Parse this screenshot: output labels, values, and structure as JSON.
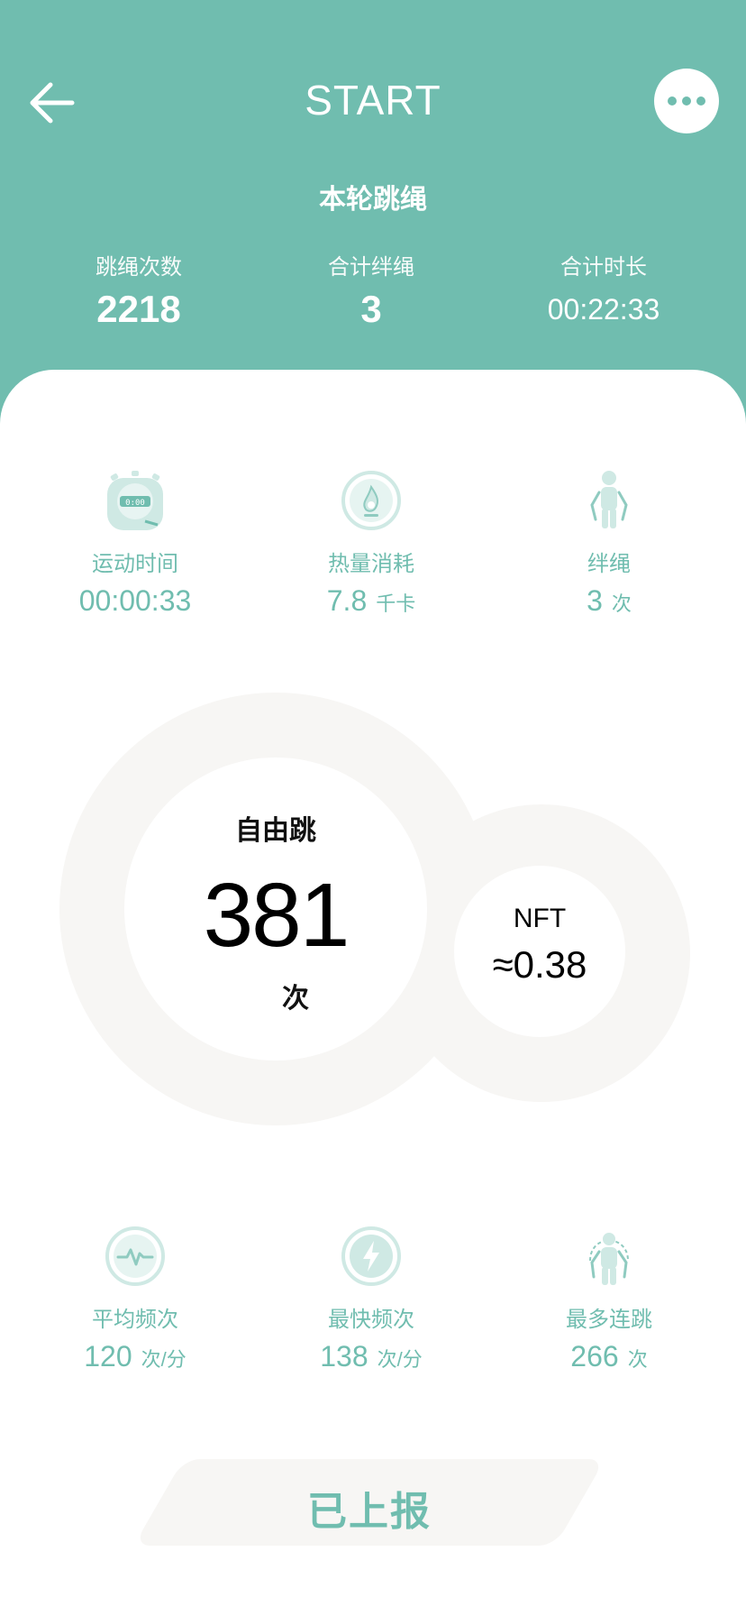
{
  "header": {
    "title": "START",
    "subtitle": "本轮跳绳",
    "summary": [
      {
        "label": "跳绳次数",
        "value": "2218"
      },
      {
        "label": "合计绊绳",
        "value": "3"
      },
      {
        "label": "合计时长",
        "value": "00:22:33"
      }
    ]
  },
  "top_stats": [
    {
      "icon": "stopwatch-icon",
      "label": "运动时间",
      "value": "00:00:33",
      "unit": ""
    },
    {
      "icon": "flame-gauge-icon",
      "label": "热量消耗",
      "value": "7.8",
      "unit": "千卡"
    },
    {
      "icon": "jumper-icon",
      "label": "绊绳",
      "value": "3",
      "unit": "次"
    }
  ],
  "main": {
    "mode": "自由跳",
    "count": "381",
    "count_unit": "次",
    "nft_label": "NFT",
    "nft_value": "≈0.38"
  },
  "bottom_stats": [
    {
      "icon": "heartbeat-icon",
      "label": "平均频次",
      "value": "120",
      "unit": "次/分"
    },
    {
      "icon": "lightning-icon",
      "label": "最快频次",
      "value": "138",
      "unit": "次/分"
    },
    {
      "icon": "rope-jump-icon",
      "label": "最多连跳",
      "value": "266",
      "unit": "次"
    }
  ],
  "button": {
    "label": "已上报"
  },
  "colors": {
    "accent": "#70bdaf",
    "ring": "#f7f6f4",
    "icon_light": "#cfe9e4"
  }
}
